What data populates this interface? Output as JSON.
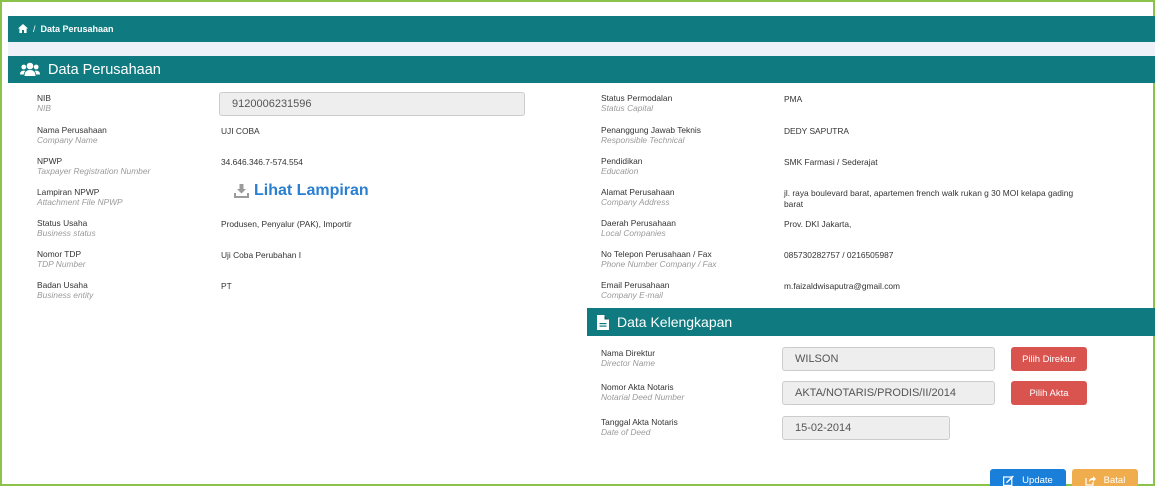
{
  "breadcrumb": {
    "current": "Data Perusahaan"
  },
  "panel": {
    "title": "Data Perusahaan"
  },
  "left": [
    {
      "label": "NIB",
      "label_en": "NIB",
      "value": "9120006231596"
    },
    {
      "label": "Nama Perusahaan",
      "label_en": "Company Name",
      "value": "UJI COBA"
    },
    {
      "label": "NPWP",
      "label_en": "Taxpayer Registration Number",
      "value": "34.646.346.7-574.554"
    },
    {
      "label": "Lampiran NPWP",
      "label_en": "Attachment File NPWP",
      "value": "Lihat Lampiran"
    },
    {
      "label": "Status Usaha",
      "label_en": "Business status",
      "value": "Produsen, Penyalur (PAK), Importir"
    },
    {
      "label": "Nomor TDP",
      "label_en": "TDP Number",
      "value": "Uji Coba Perubahan I"
    },
    {
      "label": "Badan Usaha",
      "label_en": "Business entity",
      "value": "PT"
    }
  ],
  "right": [
    {
      "label": "Status Permodalan",
      "label_en": "Status Capital",
      "value": "PMA"
    },
    {
      "label": "Penanggung Jawab Teknis",
      "label_en": "Responsible Technical",
      "value": "DEDY SAPUTRA"
    },
    {
      "label": "Pendidikan",
      "label_en": "Education",
      "value": "SMK Farmasi / Sederajat"
    },
    {
      "label": "Alamat Perusahaan",
      "label_en": "Company Address",
      "value": "jl. raya boulevard barat, apartemen french walk rukan g 30 MOI kelapa gading barat"
    },
    {
      "label": "Daerah Perusahaan",
      "label_en": "Local Companies",
      "value": "Prov. DKI Jakarta,"
    },
    {
      "label": "No Telepon Perusahaan / Fax",
      "label_en": "Phone Number Company / Fax",
      "value": "085730282757 / 0216505987"
    },
    {
      "label": "Email Perusahaan",
      "label_en": "Company E-mail",
      "value": "m.faizaldwisaputra@gmail.com"
    }
  ],
  "kelengkapan": {
    "title": "Data Kelengkapan",
    "rows": [
      {
        "label": "Nama Direktur",
        "label_en": "Director Name",
        "value": "WILSON",
        "button": "Pilih Direktur"
      },
      {
        "label": "Nomor Akta Notaris",
        "label_en": "Notarial Deed Number",
        "value": "AKTA/NOTARIS/PRODIS/II/2014",
        "button": "Pilih Akta"
      },
      {
        "label": "Tanggal Akta Notaris",
        "label_en": "Date of Deed",
        "value": "15-02-2014"
      }
    ]
  },
  "actions": {
    "update": "Update",
    "batal": "Batal"
  },
  "colors": {
    "teal": "#0f7b80",
    "link": "#2a7fd0",
    "danger": "#d9534f",
    "primary": "#1a7fd8",
    "warning": "#f0ad4e"
  }
}
